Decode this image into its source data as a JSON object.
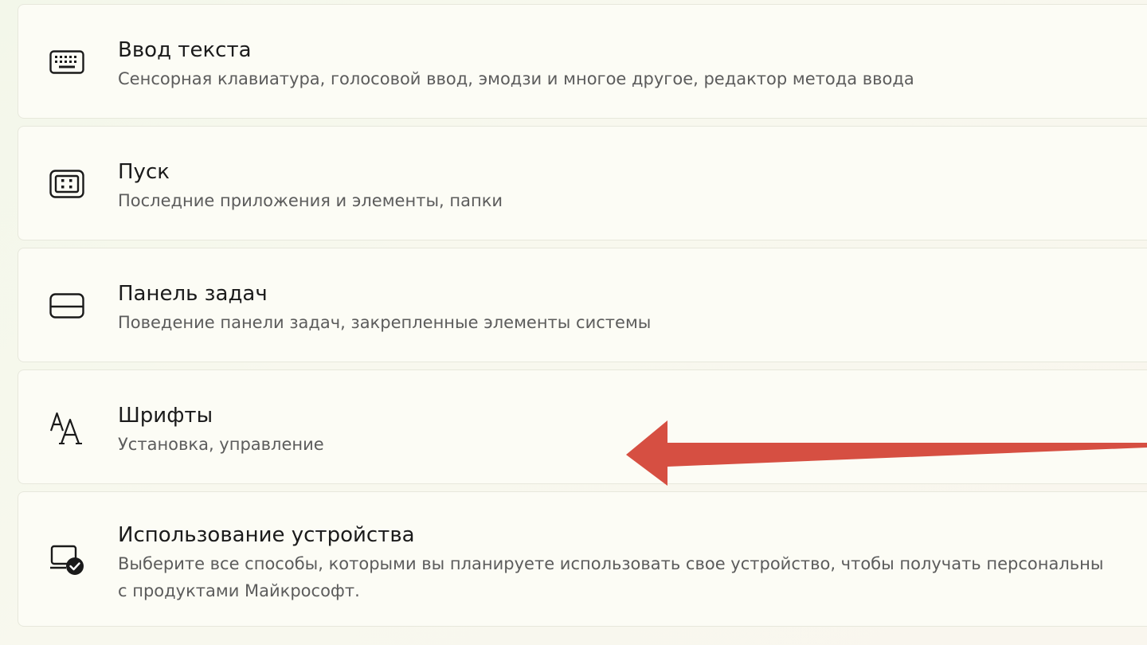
{
  "items": [
    {
      "title": "Ввод текста",
      "description": "Сенсорная клавиатура, голосовой ввод, эмодзи и многое другое, редактор метода ввода",
      "icon": "keyboard-icon"
    },
    {
      "title": "Пуск",
      "description": "Последние приложения и элементы, папки",
      "icon": "start-menu-icon"
    },
    {
      "title": "Панель задач",
      "description": "Поведение панели задач, закрепленные элементы системы",
      "icon": "taskbar-icon"
    },
    {
      "title": "Шрифты",
      "description": "Установка, управление",
      "icon": "fonts-icon"
    },
    {
      "title": "Использование устройства",
      "description_line1": "Выберите все способы, которыми вы планируете использовать свое устройство, чтобы получать персональны",
      "description_line2": "с продуктами Майкрософт.",
      "icon": "device-usage-icon"
    }
  ],
  "colors": {
    "arrow": "#d64f42",
    "card_background": "#fcfcf5",
    "title_text": "#1b1b1b",
    "description_text": "#5c5c5c"
  }
}
